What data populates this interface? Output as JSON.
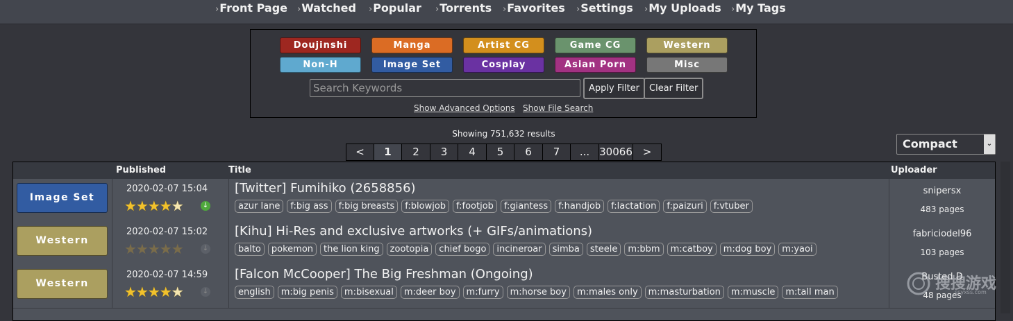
{
  "nav": {
    "items": [
      "Front Page",
      "Watched",
      "Popular",
      "Torrents",
      "Favorites",
      "Settings",
      "My Uploads",
      "My Tags"
    ]
  },
  "categories": [
    {
      "label": "Doujinshi",
      "color": "#9e2720"
    },
    {
      "label": "Manga",
      "color": "#db6c24"
    },
    {
      "label": "Artist CG",
      "color": "#d38f1d"
    },
    {
      "label": "Game CG",
      "color": "#6a936d"
    },
    {
      "label": "Western",
      "color": "#ab9f60"
    },
    {
      "label": "Non-H",
      "color": "#5fa9cf"
    },
    {
      "label": "Image Set",
      "color": "#325ca2"
    },
    {
      "label": "Cosplay",
      "color": "#6a32a2"
    },
    {
      "label": "Asian Porn",
      "color": "#a23282"
    },
    {
      "label": "Misc",
      "color": "#777777"
    }
  ],
  "search": {
    "placeholder": "Search Keywords",
    "apply_label": "Apply Filter",
    "clear_label": "Clear Filter",
    "advanced_link": "Show Advanced Options",
    "file_link": "Show File Search"
  },
  "results": {
    "showing": "Showing 751,632 results"
  },
  "pager": [
    "<",
    "1",
    "2",
    "3",
    "4",
    "5",
    "6",
    "7",
    "...",
    "30066",
    ">"
  ],
  "pager_current": "1",
  "view_mode": {
    "selected": "Compact"
  },
  "table": {
    "headers": {
      "published": "Published",
      "title": "Title",
      "uploader": "Uploader"
    },
    "rows": [
      {
        "category": "Image Set",
        "cat_color": "#325ca2",
        "published": "2020-02-07 15:04",
        "rating": 5,
        "torrent": true,
        "title": "[Twitter] Fumihiko (2658856)",
        "tags": [
          "azur lane",
          "f:big ass",
          "f:big breasts",
          "f:blowjob",
          "f:footjob",
          "f:giantess",
          "f:handjob",
          "f:lactation",
          "f:paizuri",
          "f:vtuber"
        ],
        "uploader": "snipersx",
        "pages": "483 pages"
      },
      {
        "category": "Western",
        "cat_color": "#ab9f60",
        "published": "2020-02-07 15:02",
        "rating": 0,
        "torrent": false,
        "title": "[Kihu] Hi-Res and exclusive artworks (+ GIFs/animations)",
        "tags": [
          "balto",
          "pokemon",
          "the lion king",
          "zootopia",
          "chief bogo",
          "incineroar",
          "simba",
          "steele",
          "m:bbm",
          "m:catboy",
          "m:dog boy",
          "m:yaoi"
        ],
        "uploader": "fabriciodel96",
        "pages": "103 pages"
      },
      {
        "category": "Western",
        "cat_color": "#ab9f60",
        "published": "2020-02-07 14:59",
        "rating": 5,
        "torrent": false,
        "title": "[Falcon McCooper] The Big Freshman (Ongoing)",
        "tags": [
          "english",
          "m:big penis",
          "m:bisexual",
          "m:deer boy",
          "m:furry",
          "m:horse boy",
          "m:males only",
          "m:masturbation",
          "m:muscle",
          "m:tall man"
        ],
        "uploader": "Busted D",
        "pages": "48 pages"
      }
    ]
  },
  "watermark": {
    "text": "搜搜游戏",
    "sub": "ssyxss.com"
  }
}
